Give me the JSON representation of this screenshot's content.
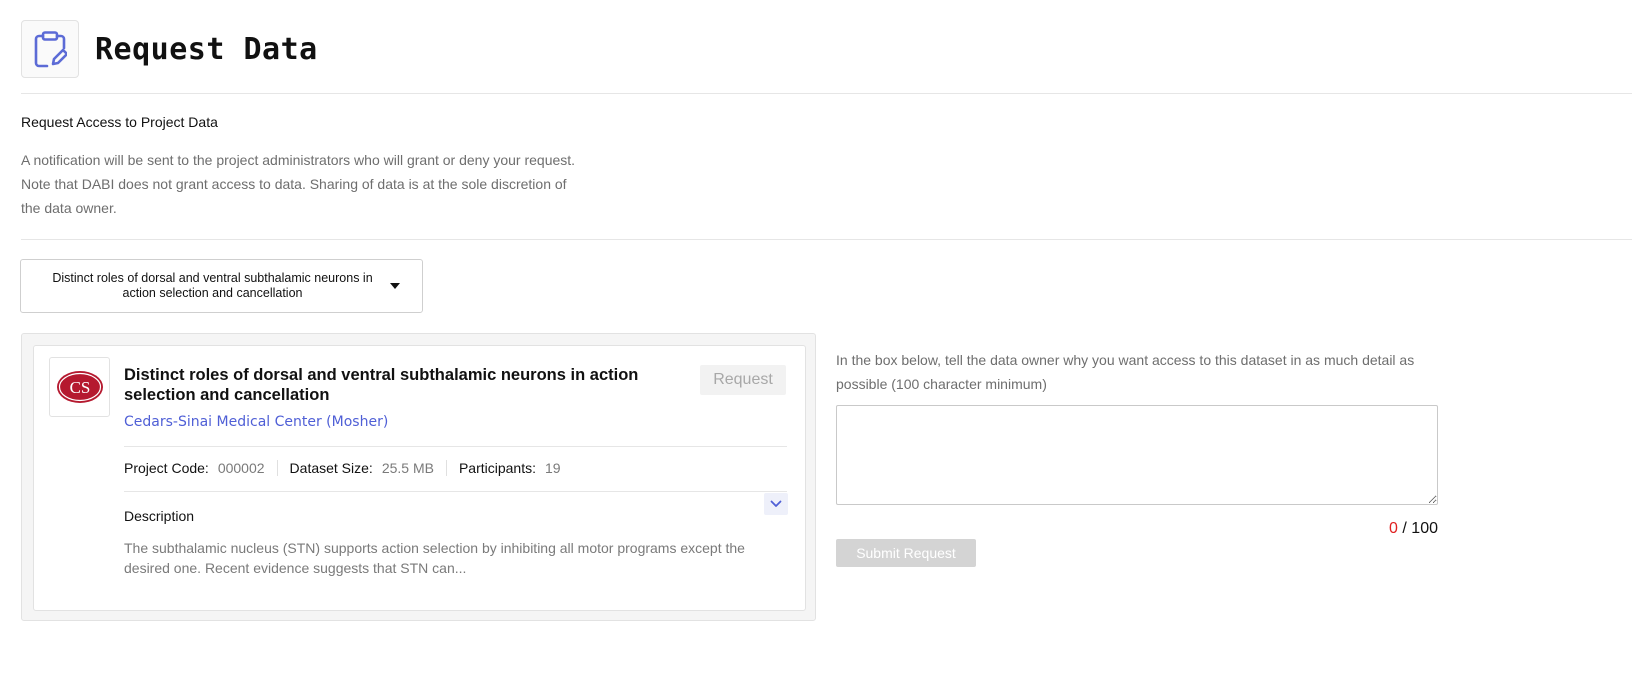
{
  "header": {
    "title": "Request Data",
    "icon": "clipboard-edit-icon",
    "icon_color": "#5c6bd6"
  },
  "section": {
    "heading": "Request Access to Project Data",
    "notice_lines": [
      "A notification will be sent to the project administrators who will grant or deny your request.",
      "Note that DABI does not grant access to data. Sharing of data is at the sole discretion of",
      "the data owner."
    ]
  },
  "project_select": {
    "selected": "Distinct roles of dorsal and ventral subthalamic neurons in action selection and cancellation",
    "icon": "caret-down-icon"
  },
  "dataset_card": {
    "logo_text": "CS",
    "logo_color": "#b5192f",
    "title": "Distinct roles of dorsal and ventral subthalamic neurons in action selection and cancellation",
    "request_label": "Request",
    "organization": "Cedars-Sinai Medical Center (Mosher)",
    "link_color": "#4f5fd6",
    "meta": {
      "project_code_label": "Project Code:",
      "project_code": "000002",
      "dataset_size_label": "Dataset Size:",
      "dataset_size": "25.5 MB",
      "participants_label": "Participants:",
      "participants": "19"
    },
    "expand_icon": "chevron-down-icon",
    "description_heading": "Description",
    "description": "The subthalamic nucleus (STN) supports action selection by inhibiting all motor programs except the desired one. Recent evidence suggests that STN can..."
  },
  "request_form": {
    "prompt": "In the box below, tell the data owner why you want access to this dataset in as much detail as possible (100 character minimum)",
    "textarea_value": "",
    "char_count": "0",
    "char_separator": "/",
    "char_min": "100",
    "count_color": "#e02020",
    "submit_label": "Submit Request"
  }
}
